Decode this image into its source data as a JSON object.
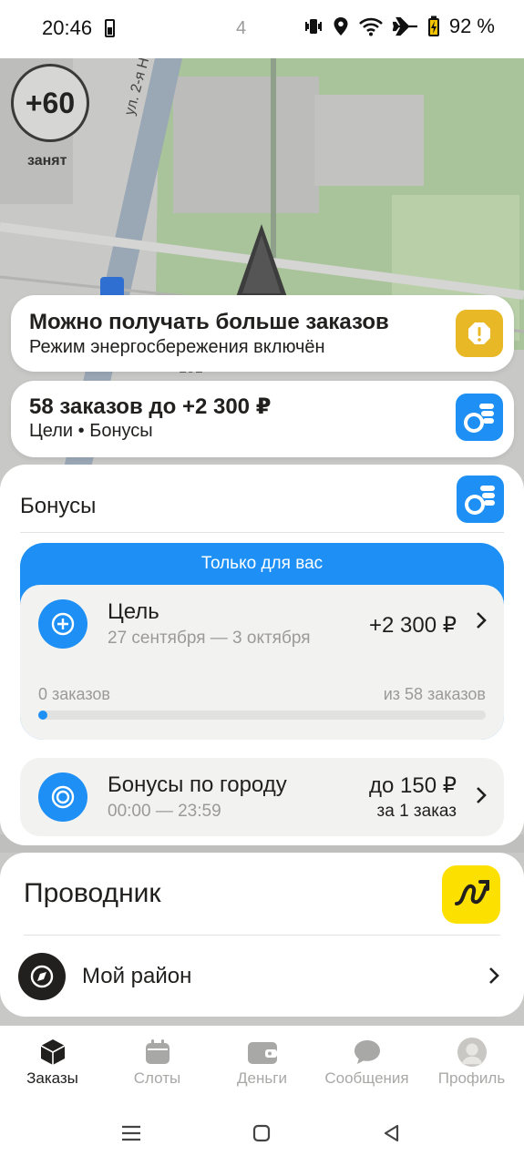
{
  "status_bar": {
    "time": "20:46",
    "notification_count": "4",
    "battery_percent": "92 %",
    "icons": [
      "battery-icon",
      "vibrate-icon",
      "location-icon",
      "wifi-icon",
      "airplane-icon",
      "battery-charging-icon"
    ]
  },
  "map": {
    "street_label": "ул. 2-я Н",
    "house_number": "151",
    "score": "+60",
    "driver_status": "занят"
  },
  "notice_card": {
    "title": "Можно получать больше заказов",
    "subtitle": "Режим энергосбережения включён",
    "icon": "warning-icon",
    "icon_color": "#e8b827"
  },
  "goal_summary_card": {
    "title": "58 заказов до +2 300 ₽",
    "subtitle": "Цели • Бонусы",
    "icon": "coins-icon"
  },
  "bonuses": {
    "title": "Бонусы",
    "exclusive_label": "Только для вас",
    "goal": {
      "title": "Цель",
      "dates": "27 сентября — 3 октября",
      "amount": "+2 300 ₽",
      "progress_start_label": "0 заказов",
      "progress_end_label": "из 58 заказов",
      "progress_fraction": 0.0
    },
    "city_bonus": {
      "title": "Бонусы по городу",
      "hours": "00:00 — 23:59",
      "amount": "до 150 ₽",
      "amount_note": "за 1 заказ"
    }
  },
  "guide": {
    "title": "Проводник",
    "district_label": "Мой район"
  },
  "tabs": [
    {
      "label": "Заказы",
      "icon": "cube-icon",
      "active": true
    },
    {
      "label": "Слоты",
      "icon": "calendar-icon",
      "active": false
    },
    {
      "label": "Деньги",
      "icon": "wallet-icon",
      "active": false
    },
    {
      "label": "Сообщения",
      "icon": "chat-icon",
      "active": false
    },
    {
      "label": "Профиль",
      "icon": "avatar",
      "active": false
    }
  ],
  "colors": {
    "accent_blue": "#1e90f5",
    "brand_yellow": "#fce000",
    "text_primary": "#21201f",
    "text_secondary": "#9b9a98"
  }
}
